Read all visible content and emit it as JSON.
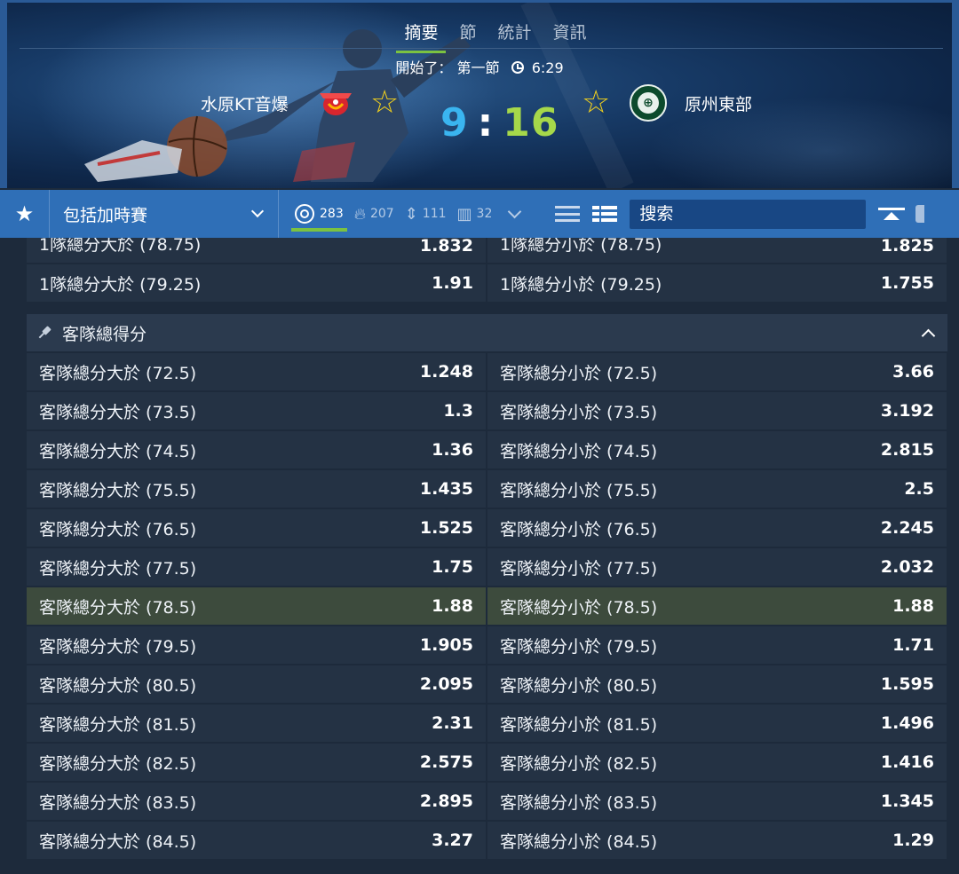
{
  "match": {
    "tabs": [
      "摘要",
      "節",
      "統計",
      "資訊"
    ],
    "status_label": "開始了：",
    "period": "第一節",
    "time": "6:29",
    "home_team": "水原KT音爆",
    "away_team": "原州東部",
    "home_score": "9",
    "score_sep": ":",
    "away_score": "16"
  },
  "toolbar": {
    "star": "★",
    "filter_label": "包括加時賽",
    "counts": [
      {
        "icon": "target-icon",
        "value": "283"
      },
      {
        "icon": "fire-icon",
        "value": "207"
      },
      {
        "icon": "updown-icon",
        "value": "111"
      },
      {
        "icon": "bars-icon",
        "value": "32"
      }
    ],
    "search_placeholder": "搜索"
  },
  "prev_rows": [
    {
      "left": "1隊總分大於 (78.75)",
      "left_odd": "1.832",
      "right": "1隊總分小於 (78.75)",
      "right_odd": "1.825"
    },
    {
      "left": "1隊總分大於 (79.25)",
      "left_odd": "1.91",
      "right": "1隊總分小於 (79.25)",
      "right_odd": "1.755"
    }
  ],
  "section": {
    "title": "客隊總得分",
    "rows": [
      {
        "left": "客隊總分大於 (72.5)",
        "left_odd": "1.248",
        "right": "客隊總分小於 (72.5)",
        "right_odd": "3.66"
      },
      {
        "left": "客隊總分大於 (73.5)",
        "left_odd": "1.3",
        "right": "客隊總分小於 (73.5)",
        "right_odd": "3.192"
      },
      {
        "left": "客隊總分大於 (74.5)",
        "left_odd": "1.36",
        "right": "客隊總分小於 (74.5)",
        "right_odd": "2.815"
      },
      {
        "left": "客隊總分大於 (75.5)",
        "left_odd": "1.435",
        "right": "客隊總分小於 (75.5)",
        "right_odd": "2.5"
      },
      {
        "left": "客隊總分大於 (76.5)",
        "left_odd": "1.525",
        "right": "客隊總分小於 (76.5)",
        "right_odd": "2.245"
      },
      {
        "left": "客隊總分大於 (77.5)",
        "left_odd": "1.75",
        "right": "客隊總分小於 (77.5)",
        "right_odd": "2.032"
      },
      {
        "left": "客隊總分大於 (78.5)",
        "left_odd": "1.88",
        "right": "客隊總分小於 (78.5)",
        "right_odd": "1.88"
      },
      {
        "left": "客隊總分大於 (79.5)",
        "left_odd": "1.905",
        "right": "客隊總分小於 (79.5)",
        "right_odd": "1.71"
      },
      {
        "left": "客隊總分大於 (80.5)",
        "left_odd": "2.095",
        "right": "客隊總分小於 (80.5)",
        "right_odd": "1.595"
      },
      {
        "left": "客隊總分大於 (81.5)",
        "left_odd": "2.31",
        "right": "客隊總分小於 (81.5)",
        "right_odd": "1.496"
      },
      {
        "left": "客隊總分大於 (82.5)",
        "left_odd": "2.575",
        "right": "客隊總分小於 (82.5)",
        "right_odd": "1.416"
      },
      {
        "left": "客隊總分大於 (83.5)",
        "left_odd": "2.895",
        "right": "客隊總分小於 (83.5)",
        "right_odd": "1.345"
      },
      {
        "left": "客隊總分大於 (84.5)",
        "left_odd": "3.27",
        "right": "客隊總分小於 (84.5)",
        "right_odd": "1.29"
      }
    ]
  },
  "colors": {
    "home_score": "#3ab5f0",
    "away_score": "#a6d84a",
    "toolbar": "#2f6fb7",
    "active_underline": "#7bc241",
    "star": "#f4d21c",
    "cell_bg": "#243244",
    "selected_row_bg": "#3d4b3d"
  }
}
